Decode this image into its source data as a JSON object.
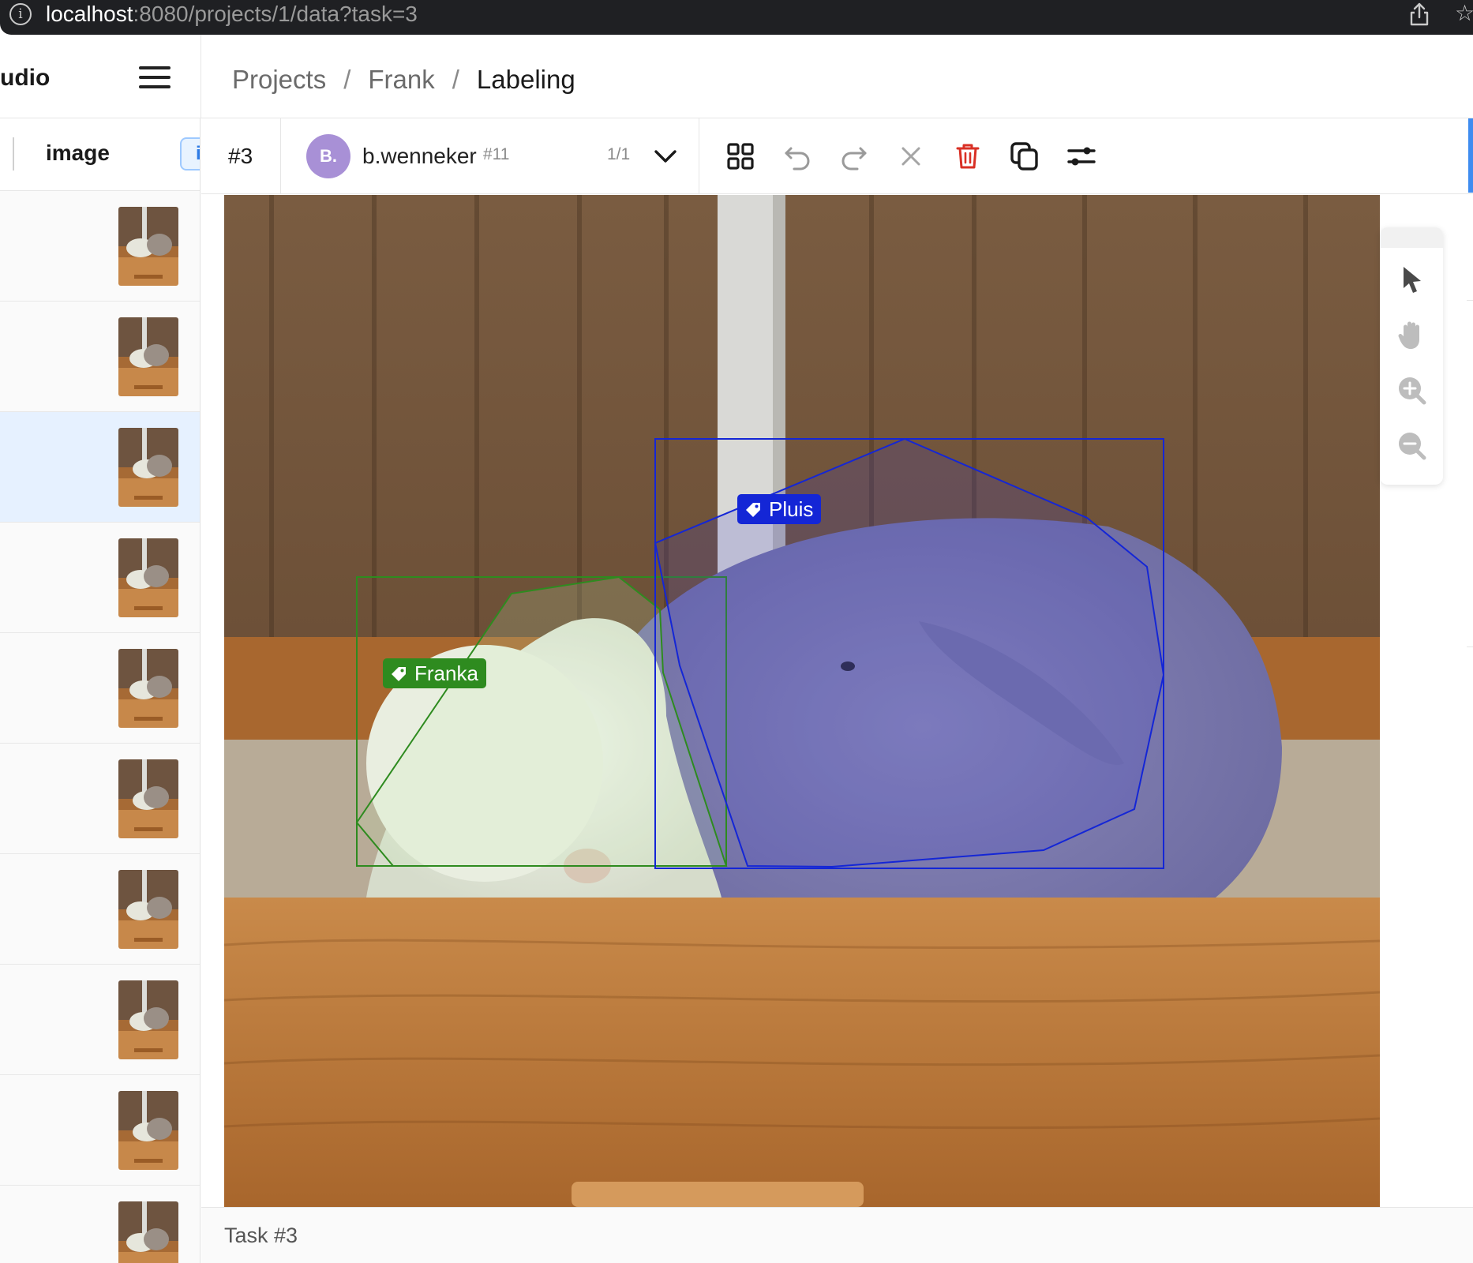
{
  "browser": {
    "url_host": "localhost",
    "url_path": ":8080/projects/1/data?task=3"
  },
  "header": {
    "brand_partial": "udio",
    "breadcrumb": [
      "Projects",
      "Frank",
      "Labeling"
    ],
    "separator": "/"
  },
  "task_list": {
    "column": "image",
    "column_chip": "i",
    "rows": 10,
    "selected_index": 2
  },
  "toolbar": {
    "task_id": "#3",
    "annotator_initials": "B.",
    "annotator_name": "b.wenneker",
    "annotation_id": "#11",
    "annotation_count": "1/1",
    "accent_color": "#a890d6",
    "icons": [
      "grid-icon",
      "undo-icon",
      "redo-icon",
      "close-icon",
      "trash-icon",
      "copy-icon",
      "settings-sliders-icon"
    ]
  },
  "canvas": {
    "regions": [
      {
        "label": "Pluis",
        "color": "#1426d6"
      },
      {
        "label": "Franka",
        "color": "#2e8b1f"
      }
    ],
    "side_tools": [
      "cursor-icon",
      "hand-icon",
      "zoom-in-icon",
      "zoom-out-icon"
    ]
  },
  "footer": {
    "label": "Task #3"
  }
}
